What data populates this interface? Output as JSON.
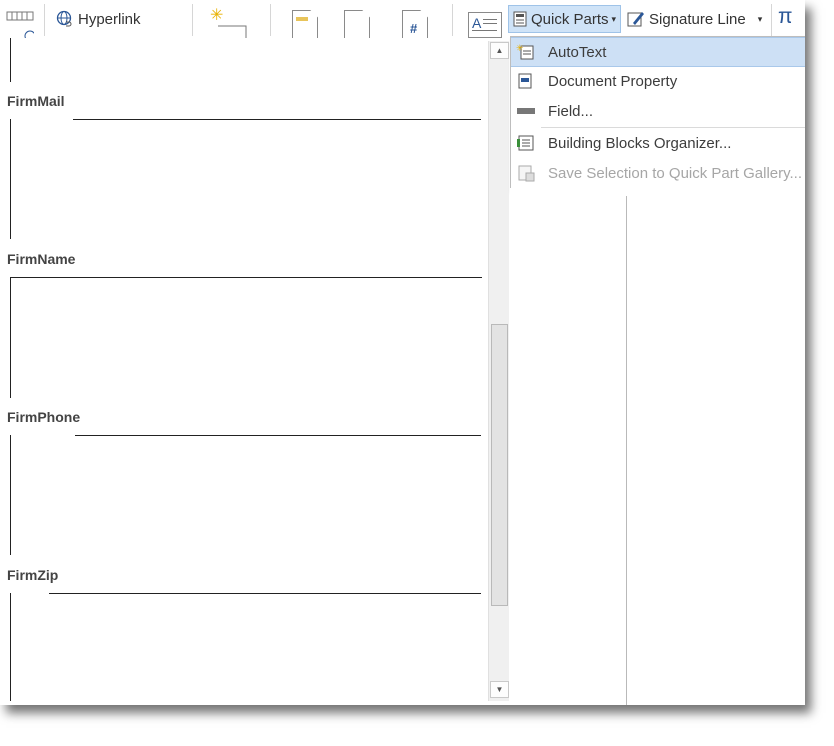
{
  "ribbon": {
    "hyperlink_label": "Hyperlink",
    "quick_parts_label": "Quick Parts",
    "signature_line_label": "Signature Line",
    "pi_symbol": "π"
  },
  "gallery": {
    "entries": [
      {
        "title": "FirmMail"
      },
      {
        "title": "FirmName"
      },
      {
        "title": "FirmPhone"
      },
      {
        "title": "FirmZip"
      }
    ]
  },
  "menu": {
    "items": [
      {
        "label": "AutoText",
        "icon": "autotext-icon",
        "state": "hover"
      },
      {
        "label": "Document Property",
        "icon": "document-property-icon",
        "state": "normal"
      },
      {
        "label": "Field...",
        "icon": "field-icon",
        "state": "normal"
      },
      {
        "label": "Building Blocks Organizer...",
        "icon": "building-blocks-icon",
        "state": "normal"
      },
      {
        "label": "Save Selection to Quick Part Gallery...",
        "icon": "save-selection-icon",
        "state": "disabled"
      }
    ]
  },
  "colors": {
    "accent_active": "#cfe3f7",
    "menu_hover": "#cde0f5",
    "pi_blue": "#2b5797",
    "disabled_text": "#a6a6a6"
  }
}
